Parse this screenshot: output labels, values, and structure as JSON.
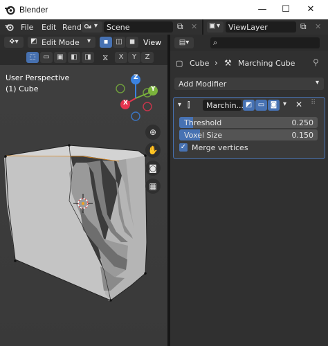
{
  "titlebar": {
    "title": "Blender",
    "minimize": "—",
    "maximize": "☐",
    "close": "✕"
  },
  "menubar": {
    "items": [
      "File",
      "Edit",
      "Rend"
    ],
    "scene": "Scene",
    "view_layer": "ViewLayer"
  },
  "viewport": {
    "mode": "Edit Mode",
    "view_menu": "View",
    "axis_buttons": [
      "X",
      "Y",
      "Z"
    ],
    "overlay_line1": "User Perspective",
    "overlay_line2": "(1) Cube",
    "gizmo": {
      "x": "X",
      "y": "Y",
      "z": "Z"
    }
  },
  "properties": {
    "search_placeholder": "",
    "breadcrumb_object": "Cube",
    "breadcrumb_modifier": "Marching Cube",
    "add_modifier": "Add Modifier",
    "modifier": {
      "name": "Marchin...",
      "threshold_label": "Threshold",
      "threshold_value": "0.250",
      "threshold_fraction": 0.1,
      "voxel_label": "Voxel Size",
      "voxel_value": "0.150",
      "voxel_fraction": 0.15,
      "merge_label": "Merge vertices",
      "merge_checked": true
    }
  },
  "colors": {
    "accent": "#4772b3",
    "axis_x": "#e5344f",
    "axis_y": "#7bb33c",
    "axis_z": "#3b82e0"
  }
}
